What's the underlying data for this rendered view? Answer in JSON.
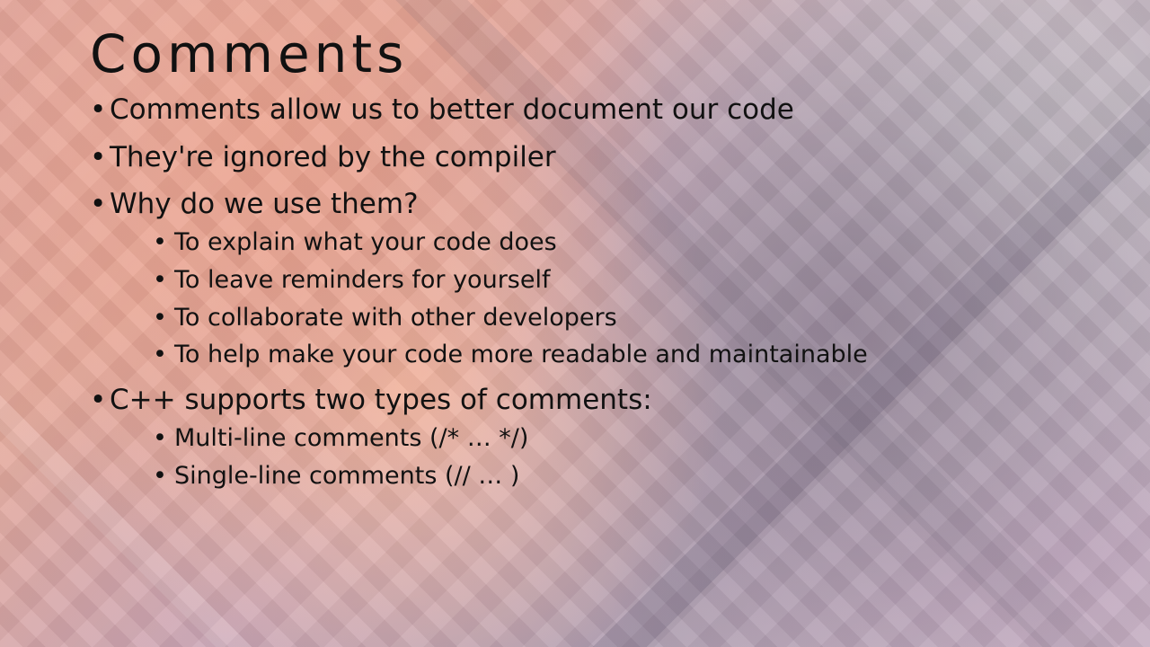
{
  "slide": {
    "title": "Comments",
    "bullets": [
      {
        "text": "Comments allow us to better document our code"
      },
      {
        "text": "They're ignored by the compiler"
      },
      {
        "text": "Why do we use them?",
        "subitems": [
          "To explain what your code does",
          "To leave reminders for yourself",
          "To collaborate with other developers",
          "To help make your code more readable and maintainable"
        ]
      },
      {
        "text": "C++ supports two types of comments:",
        "subitems": [
          "Multi-line comments (/* … */)",
          "Single-line comments (// … )"
        ]
      }
    ]
  }
}
